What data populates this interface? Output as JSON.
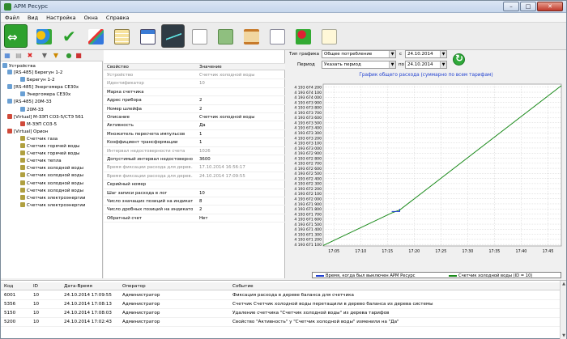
{
  "window": {
    "title": "АРМ Ресурс",
    "btn_min": "–",
    "btn_max": "□",
    "btn_close": "✕"
  },
  "menu": [
    "Файл",
    "Вид",
    "Настройка",
    "Окна",
    "Справка"
  ],
  "toolbar_icons": [
    "back-forward-icon",
    "users-icon",
    "checkmark-icon",
    "tools-icon",
    "table-icon",
    "dashboard-icon",
    "chart-icon",
    "document-icon",
    "money-icon",
    "hourglass-icon",
    "envelope-icon",
    "user-settings-icon",
    "report-icon"
  ],
  "tree": {
    "root": "Устройства",
    "nodes": [
      {
        "label": "[RS-485] Берегун 1-2",
        "level": 1,
        "icon": "port"
      },
      {
        "label": "Берегун 1-2",
        "level": 2,
        "icon": "dev"
      },
      {
        "label": "[RS-485] Энергомера СЕ30x",
        "level": 1,
        "icon": "port"
      },
      {
        "label": "Энергомера СЕ30x",
        "level": 2,
        "icon": "dev"
      },
      {
        "label": "[RS-485] 20М-33",
        "level": 1,
        "icon": "port"
      },
      {
        "label": "20М-33",
        "level": 2,
        "icon": "dev"
      },
      {
        "label": "[Virtual] М-ЗЭП СО3-5/СТЭ 561",
        "level": 1,
        "icon": "red"
      },
      {
        "label": "М-ЗЭП СО3-5",
        "level": 2,
        "icon": "red"
      },
      {
        "label": "[Virtual] Орион",
        "level": 1,
        "icon": "red"
      },
      {
        "label": "Счетчик газа",
        "level": 2,
        "icon": "tl"
      },
      {
        "label": "Счетчик горячей воды",
        "level": 2,
        "icon": "tl"
      },
      {
        "label": "Счетчик горячей воды",
        "level": 2,
        "icon": "tl"
      },
      {
        "label": "Счетчик тепла",
        "level": 2,
        "icon": "tl"
      },
      {
        "label": "Счетчик холодной воды",
        "level": 2,
        "icon": "tl"
      },
      {
        "label": "Счетчик холодной воды",
        "level": 2,
        "icon": "tl"
      },
      {
        "label": "Счетчик холодной воды",
        "level": 2,
        "icon": "tl"
      },
      {
        "label": "Счетчик холодной воды",
        "level": 2,
        "icon": "tl"
      },
      {
        "label": "Счетчик электроэнергии",
        "level": 2,
        "icon": "tl"
      },
      {
        "label": "Счетчик электроэнергии",
        "level": 2,
        "icon": "tl"
      }
    ]
  },
  "props": {
    "col_property": "Свойство",
    "col_value": "Значение",
    "rows": [
      {
        "k": "Устройство",
        "v": "Счетчик холодной воды",
        "dim": true
      },
      {
        "k": "Идентификатор",
        "v": "10",
        "dim": true
      },
      {
        "k": "Марка счетчика",
        "v": "",
        "dim": false
      },
      {
        "k": "Адрес прибора",
        "v": "2",
        "dim": false
      },
      {
        "k": "Номер шлейфа",
        "v": "2",
        "dim": false
      },
      {
        "k": "Описание",
        "v": "Счетчик холодной воды",
        "dim": false
      },
      {
        "k": "Активность",
        "v": "Да",
        "dim": false
      },
      {
        "k": "Множитель пересчета импульсов",
        "v": "1",
        "dim": false
      },
      {
        "k": "Коэффициент трансформации",
        "v": "1",
        "dim": false
      },
      {
        "k": "Интервал недостоверности счета",
        "v": "1026",
        "dim": true
      },
      {
        "k": "Допустимый интервал недостоверно...",
        "v": "3600",
        "dim": false
      },
      {
        "k": "Время фиксации расхода для дерев...",
        "v": "17.10.2014 16:56:17",
        "dim": true
      },
      {
        "k": "Время фиксации расхода для дерев...",
        "v": "24.10.2014 17:09:55",
        "dim": true
      },
      {
        "k": "Серийный номер",
        "v": "",
        "dim": false
      },
      {
        "k": "Шаг записи расхода в лог",
        "v": "10",
        "dim": false
      },
      {
        "k": "Число значащих позиций на индикат...",
        "v": "8",
        "dim": false
      },
      {
        "k": "Число дробных позиций на индикато...",
        "v": "2",
        "dim": false
      },
      {
        "k": "Обратный счет",
        "v": "Нет",
        "dim": false
      }
    ]
  },
  "controls": {
    "chart_type_label": "Тип графика",
    "chart_type_value": "Общее потребление",
    "period_label": "Период",
    "period_value": "Указать период",
    "from_label": "с",
    "from_value": "24.10.2014",
    "to_label": "по",
    "to_value": "24.10.2014",
    "dropdown_arrow": "▼"
  },
  "chart_data": {
    "type": "line",
    "title": "График общего расхода (суммарно по всем тарифам)",
    "x_ticks": [
      "17:05",
      "17:10",
      "17:15",
      "17:20",
      "17:25",
      "17:30",
      "17:35",
      "17:40",
      "17:45"
    ],
    "y_ticks": [
      "4 193 674 200",
      "4 193 674 100",
      "4 193 674 000",
      "4 193 673 900",
      "4 193 673 800",
      "4 193 673 700",
      "4 193 673 600",
      "4 193 673 500",
      "4 193 673 400",
      "4 193 673 300",
      "4 193 673 200",
      "4 193 673 100",
      "4 193 673 000",
      "4 193 672 900",
      "4 193 672 800",
      "4 193 672 700",
      "4 193 672 600",
      "4 193 672 500",
      "4 193 672 400",
      "4 193 672 300",
      "4 193 672 200",
      "4 193 672 100",
      "4 193 672 000",
      "4 193 671 900",
      "4 193 671 800",
      "4 193 671 700",
      "4 193 671 600",
      "4 193 671 500",
      "4 193 671 400",
      "4 193 671 300",
      "4 193 671 200",
      "4 193 671 100"
    ],
    "xlim_minutes": [
      0,
      44.5
    ],
    "ylim": [
      4193671070,
      4193674260
    ],
    "grid": true,
    "series": [
      {
        "name": "Время, когда был выключен АРМ Ресурс",
        "color": "#1f3fd0",
        "points": [
          [
            12.8,
            4193671750
          ],
          [
            14.3,
            4193671750
          ],
          [
            14.3,
            4193671800
          ]
        ]
      },
      {
        "name": "Счетчик холодной воды (ID = 10)",
        "color": "#1a8a1a",
        "points": [
          [
            0,
            4193671080
          ],
          [
            12.8,
            4193671720
          ],
          [
            14.3,
            4193671780
          ],
          [
            44.5,
            4193674230
          ]
        ]
      }
    ]
  },
  "log": {
    "columns": [
      "Код",
      "ID",
      "Дата-Время",
      "Оператор",
      "Событие"
    ],
    "rows": [
      {
        "code": "6001",
        "id": "10",
        "dt": "24.10.2014 17:09:55",
        "op": "Администратор",
        "ev": "Фиксация расхода в дереве баланса для счетчика"
      },
      {
        "code": "5356",
        "id": "10",
        "dt": "24.10.2014 17:08:13",
        "op": "Администратор",
        "ev": "Счетчик Счетчик холодной воды перетащили в дерево баланса из дерева системы"
      },
      {
        "code": "5150",
        "id": "10",
        "dt": "24.10.2014 17:08:03",
        "op": "Администратор",
        "ev": "Удаление счетчика \"Счетчик холодной воды\" из дерева тарифов"
      },
      {
        "code": "5200",
        "id": "10",
        "dt": "24.10.2014 17:02:43",
        "op": "Администратор",
        "ev": "Свойство \"Активность\" у \"Счетчик холодной воды\" изменили на \"Да\""
      }
    ]
  }
}
